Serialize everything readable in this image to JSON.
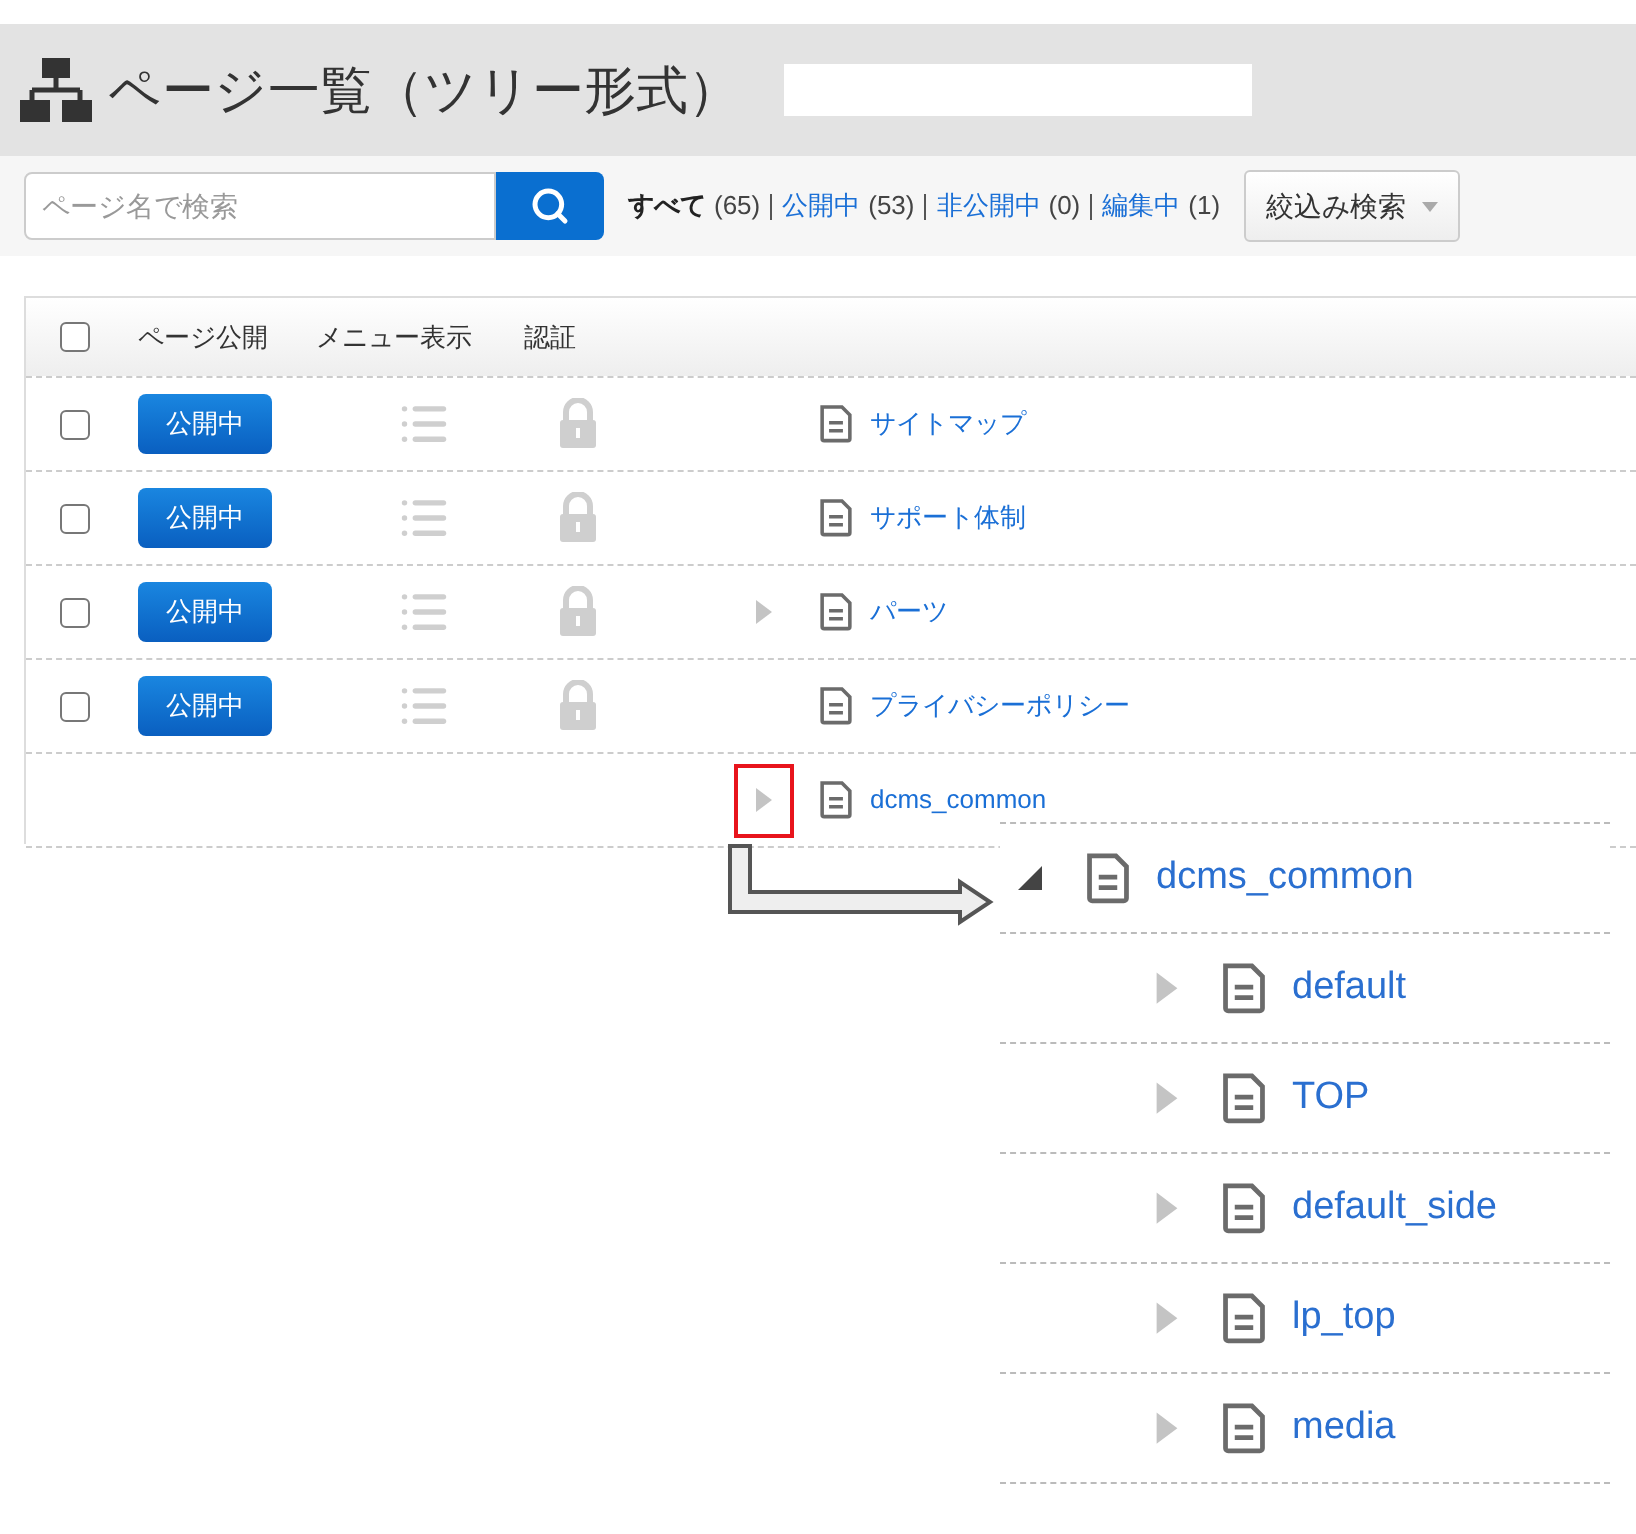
{
  "header": {
    "title": "ページ一覧（ツリー形式）"
  },
  "search": {
    "placeholder": "ページ名で検索"
  },
  "filters": [
    {
      "label": "すべて",
      "count": "(65)",
      "selected": true
    },
    {
      "label": "公開中",
      "count": "(53)",
      "selected": false
    },
    {
      "label": "非公開中",
      "count": "(0)",
      "selected": false
    },
    {
      "label": "編集中",
      "count": "(1)",
      "selected": false
    }
  ],
  "filter_button": {
    "label": "絞込み検索"
  },
  "table": {
    "select_all_checked": false,
    "columns": [
      "ページ公開",
      "メニュー表示",
      "認証"
    ],
    "rows": [
      {
        "checked": false,
        "status": "公開中",
        "title": "サイトマップ",
        "has_children": false,
        "marked": false
      },
      {
        "checked": false,
        "status": "公開中",
        "title": "サポート体制",
        "has_children": false,
        "marked": false
      },
      {
        "checked": false,
        "status": "公開中",
        "title": "パーツ",
        "has_children": true,
        "marked": false
      },
      {
        "checked": false,
        "status": "公開中",
        "title": "プライバシーポリシー",
        "has_children": false,
        "marked": false
      },
      {
        "title": "dcms_common",
        "has_children": true,
        "marked": true
      }
    ]
  },
  "zoom_view": {
    "items": [
      {
        "title": "dcms_common",
        "expanded": true,
        "children": [
          {
            "title": "default",
            "expanded": false
          },
          {
            "title": "TOP",
            "expanded": false
          },
          {
            "title": "default_side",
            "expanded": false
          },
          {
            "title": "lp_top",
            "expanded": false
          },
          {
            "title": "media",
            "expanded": false
          }
        ]
      }
    ]
  }
}
